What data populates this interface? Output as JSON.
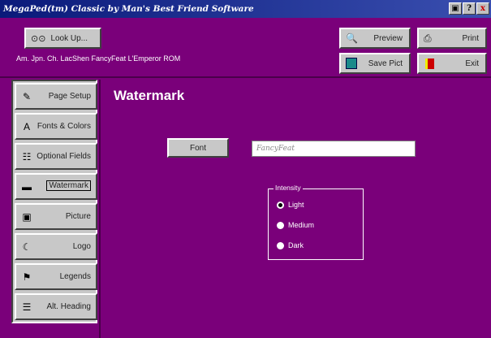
{
  "window": {
    "title": "MegaPed(tm) Classic by Man's Best Friend Software",
    "buttons": {
      "help": "?",
      "minimize": "_",
      "close": "x"
    }
  },
  "toolbar": {
    "lookup_label": "Look Up...",
    "preview_label": "Preview",
    "print_label": "Print",
    "save_pict_label": "Save Pict",
    "exit_label": "Exit"
  },
  "status": {
    "dog_name": "Am. Jpn. Ch. LacShen FancyFeat L'Emperor ROM"
  },
  "sidebar": {
    "items": [
      {
        "label": "Page Setup",
        "icon": "page-setup-icon",
        "glyph": "✎"
      },
      {
        "label": "Fonts & Colors",
        "icon": "fonts-icon",
        "glyph": "A"
      },
      {
        "label": "Optional Fields",
        "icon": "fields-icon",
        "glyph": "☷"
      },
      {
        "label": "Watermark",
        "icon": "watermark-icon",
        "glyph": "▬"
      },
      {
        "label": "Picture",
        "icon": "picture-icon",
        "glyph": "▣"
      },
      {
        "label": "Logo",
        "icon": "logo-icon",
        "glyph": "☾"
      },
      {
        "label": "Legends",
        "icon": "legends-icon",
        "glyph": "⚑"
      },
      {
        "label": "Alt. Heading",
        "icon": "alt-heading-icon",
        "glyph": "☰"
      }
    ],
    "active_index": 3
  },
  "main": {
    "title": "Watermark",
    "font_button_label": "Font",
    "font_value": "FancyFeat",
    "intensity": {
      "legend": "Intensity",
      "options": [
        "Light",
        "Medium",
        "Dark"
      ],
      "selected": "Light"
    }
  },
  "colors": {
    "background": "#7a007a",
    "title_bar": "#0a1a7a",
    "button_face": "#c8c8c8"
  }
}
